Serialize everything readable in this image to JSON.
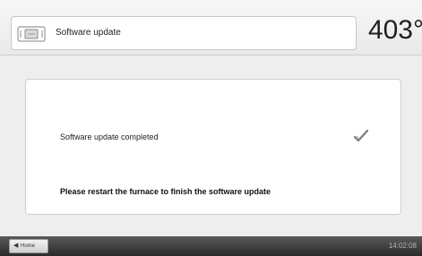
{
  "header": {
    "device_icon": "furnace-icon",
    "title": "Software update",
    "temperature": "403°"
  },
  "main": {
    "status_message": "Software update completed",
    "status_icon": "checkmark-icon",
    "instruction": "Please restart the furnace to finish the software update"
  },
  "footer": {
    "home_label": "Home",
    "home_icon": "back-arrow-icon",
    "clock": "14:02:08"
  }
}
